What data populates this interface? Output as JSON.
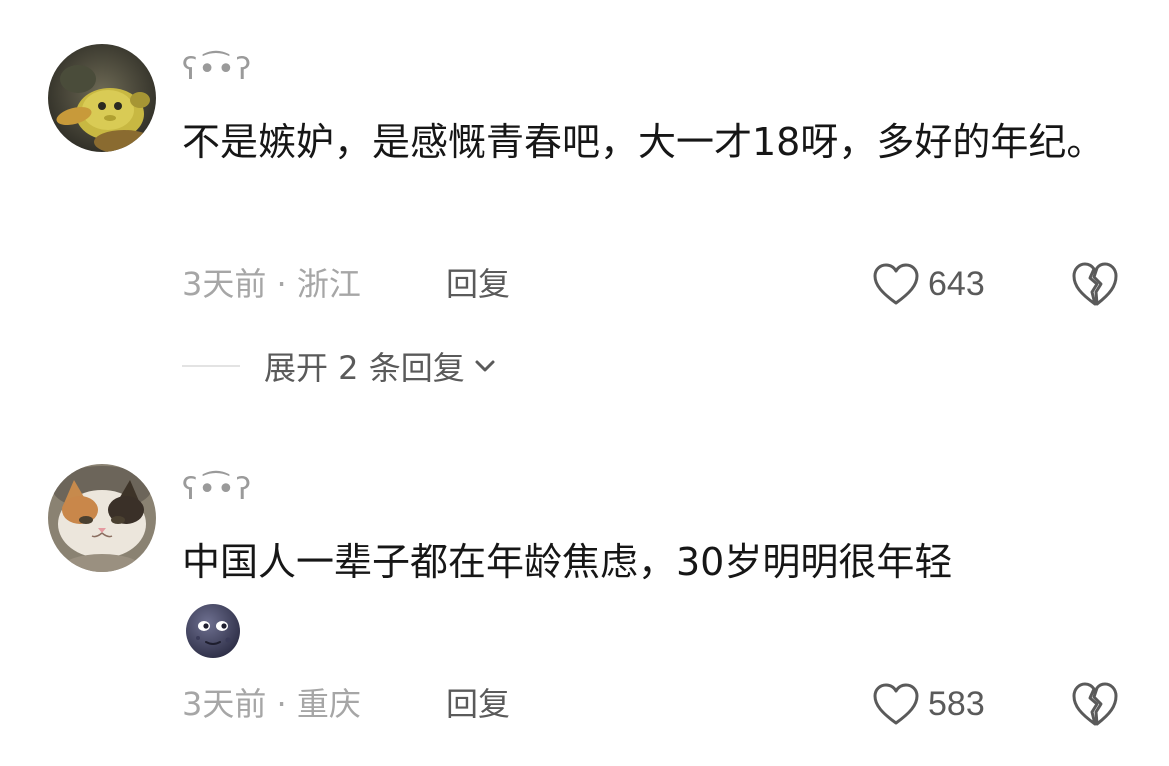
{
  "comments": [
    {
      "username": "ʕ•͡•ʔ",
      "text": "不是嫉妒，是感慨青春吧，大一才18呀，多好的年纪。",
      "time": "3天前",
      "location": "浙江",
      "reply_label": "回复",
      "likes": "643",
      "expand_label": "展开 2 条回复",
      "avatar_icon": "yellow-plush-toy-avatar"
    },
    {
      "username": "ʕ•͡•ʔ",
      "text": "中国人一辈子都在年龄焦虑，30岁明明很年轻",
      "emoji_icon": "new-moon-face-emoji",
      "time": "3天前",
      "location": "重庆",
      "reply_label": "回复",
      "likes": "583",
      "avatar_icon": "cat-face-avatar"
    }
  ],
  "separator": "·",
  "colors": {
    "text_primary": "#161616",
    "text_secondary": "#a6a6a6",
    "text_action": "#5a5a5a",
    "icon": "#5a5a5a"
  }
}
